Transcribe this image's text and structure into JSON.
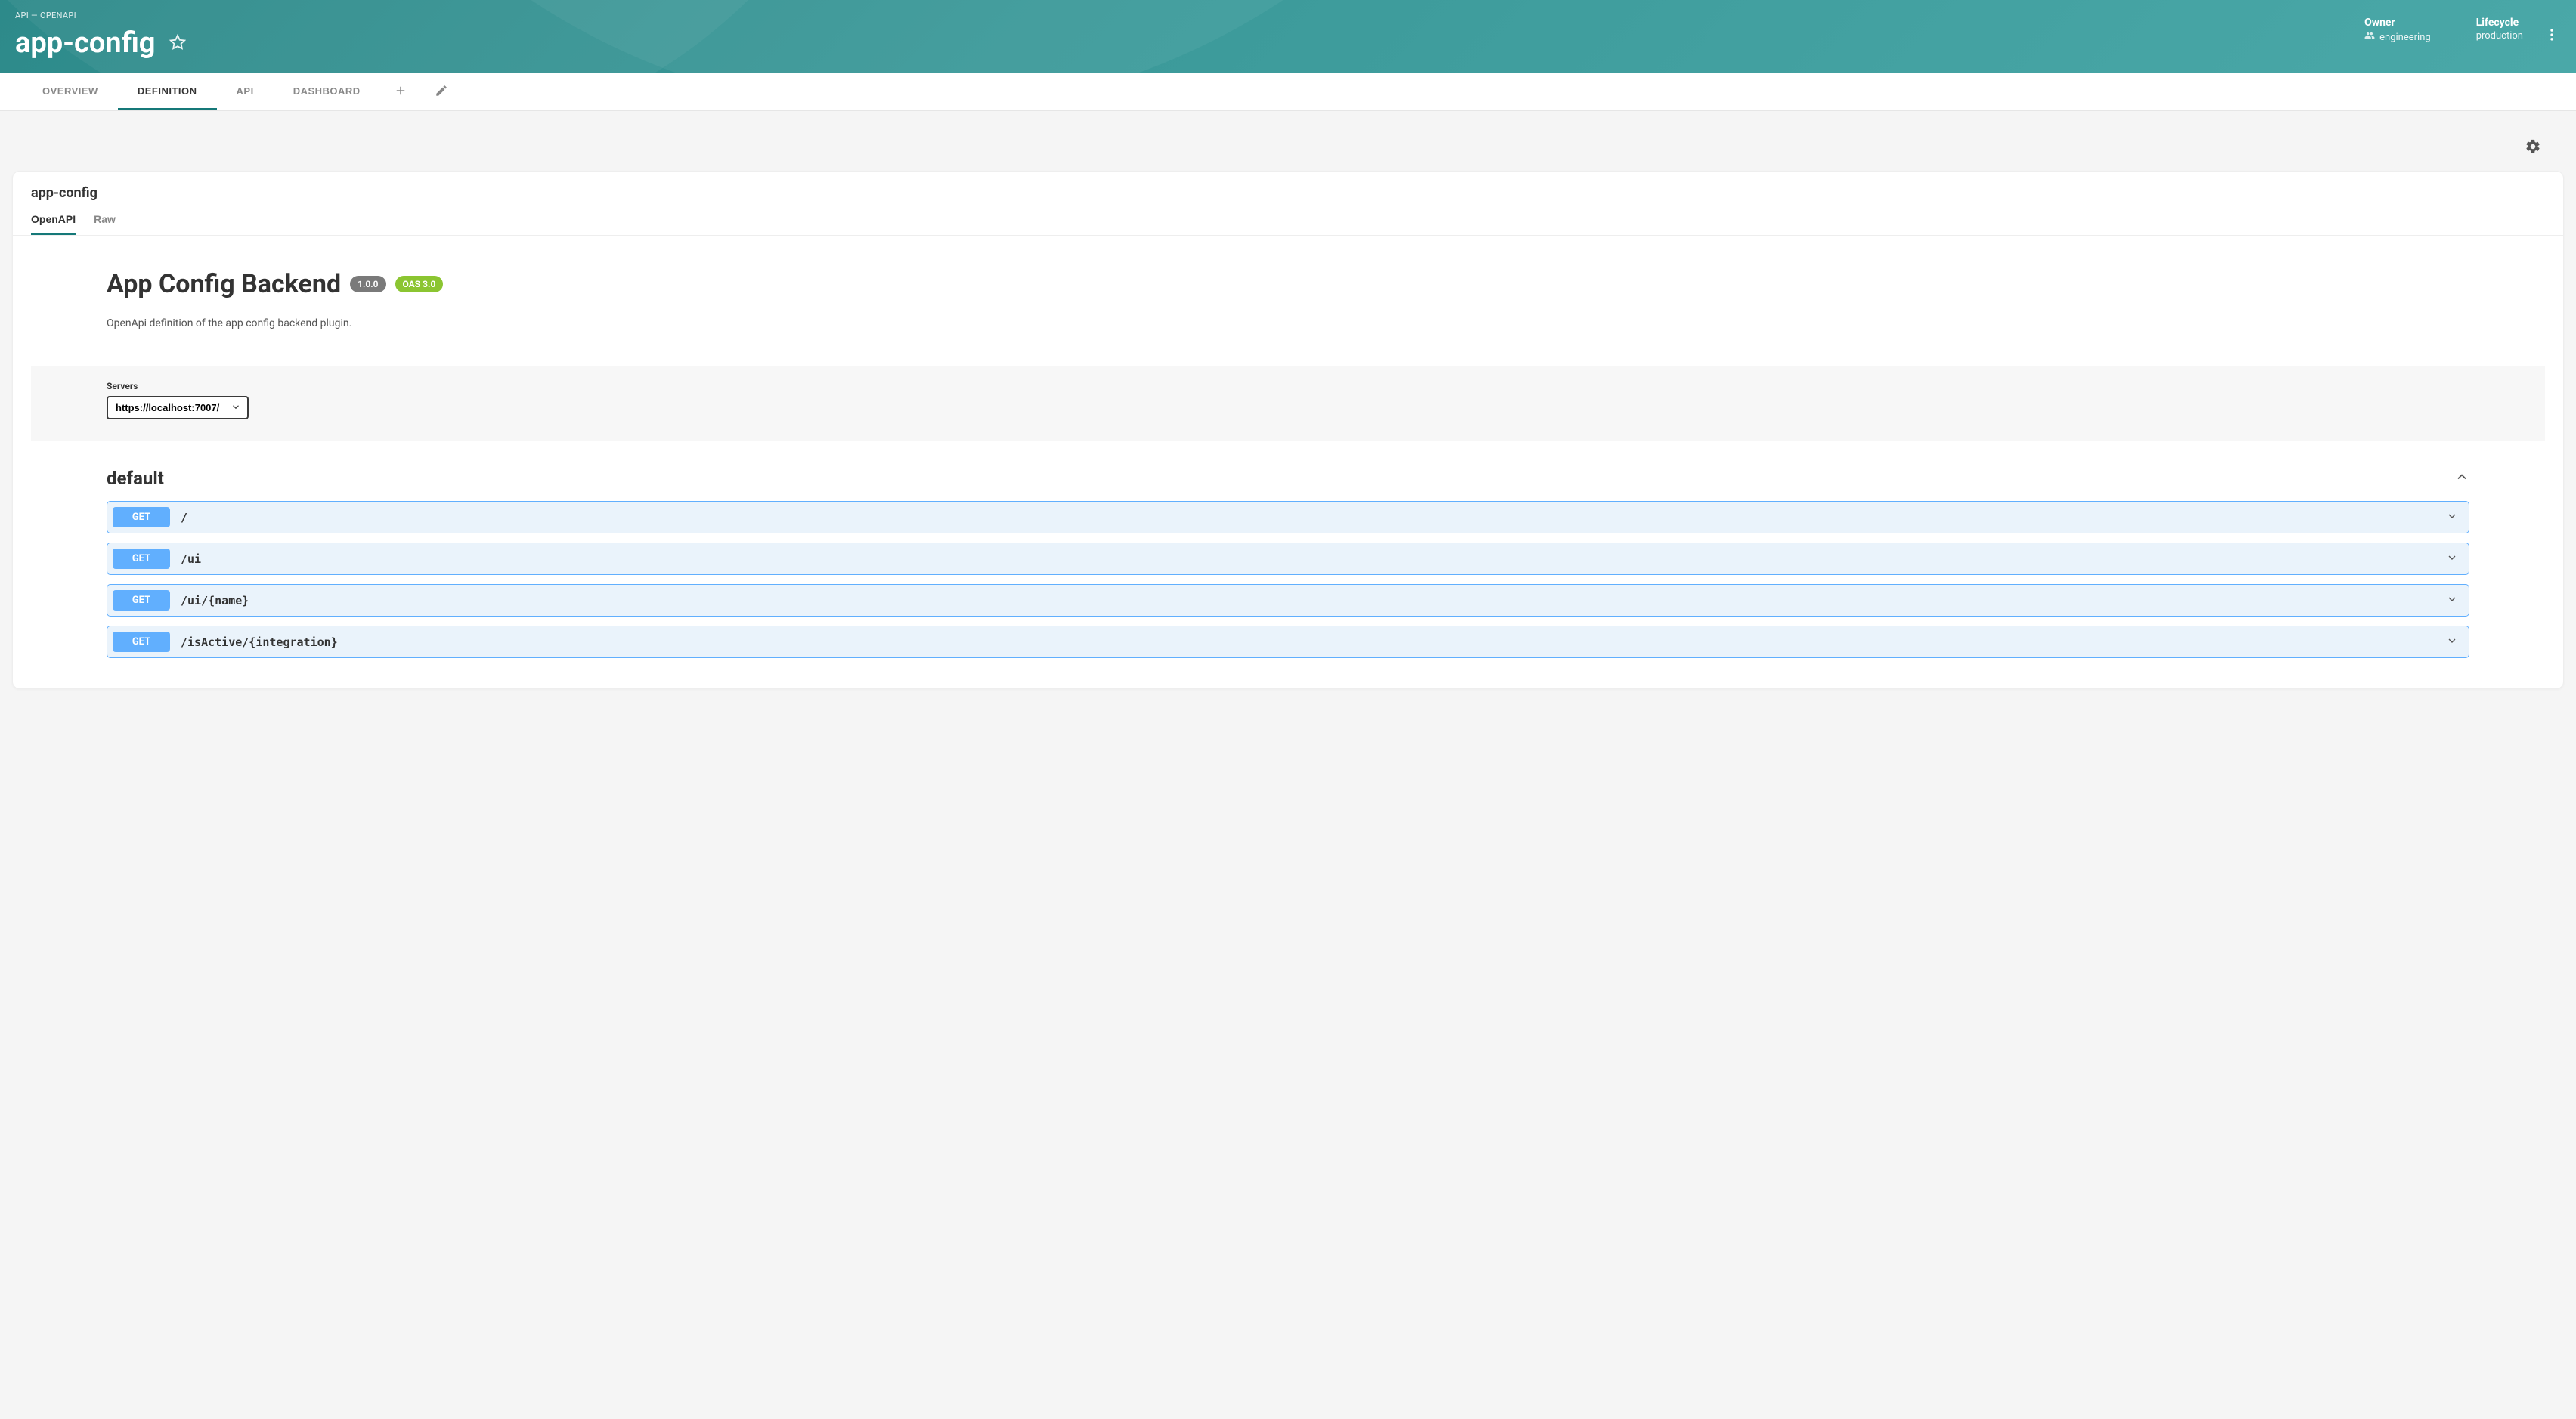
{
  "breadcrumb": "API — OPENAPI",
  "page_title": "app-config",
  "meta": {
    "owner_label": "Owner",
    "owner_value": "engineering",
    "lifecycle_label": "Lifecycle",
    "lifecycle_value": "production"
  },
  "tabs": {
    "overview": "OVERVIEW",
    "definition": "DEFINITION",
    "api": "API",
    "dashboard": "DASHBOARD"
  },
  "card": {
    "title": "app-config",
    "subtabs": {
      "openapi": "OpenAPI",
      "raw": "Raw"
    }
  },
  "api": {
    "title": "App Config Backend",
    "version": "1.0.0",
    "oas": "OAS 3.0",
    "description": "OpenApi definition of the app config backend plugin."
  },
  "servers": {
    "label": "Servers",
    "selected": "https://localhost:7007/"
  },
  "group": {
    "name": "default",
    "ops": [
      {
        "method": "GET",
        "path": "/"
      },
      {
        "method": "GET",
        "path": "/ui"
      },
      {
        "method": "GET",
        "path": "/ui/{name}"
      },
      {
        "method": "GET",
        "path": "/isActive/{integration}"
      }
    ]
  }
}
